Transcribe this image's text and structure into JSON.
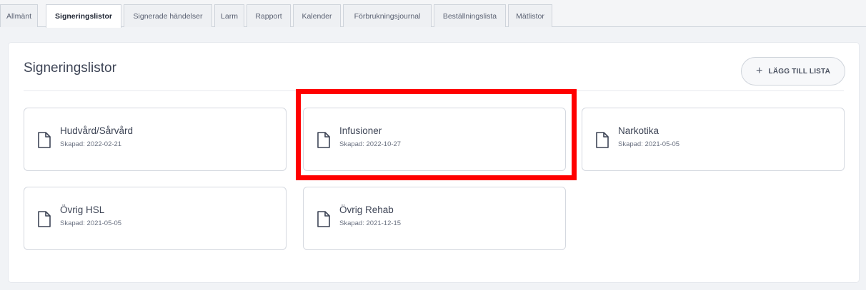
{
  "tabs": [
    {
      "label": "Allmänt",
      "active": false
    },
    {
      "label": "Signeringslistor",
      "active": true
    },
    {
      "label": "Signerade händelser",
      "active": false
    },
    {
      "label": "Larm",
      "active": false
    },
    {
      "label": "Rapport",
      "active": false
    },
    {
      "label": "Kalender",
      "active": false
    },
    {
      "label": "Förbrukningsjournal",
      "active": false
    },
    {
      "label": "Beställningslista",
      "active": false
    },
    {
      "label": "Mätlistor",
      "active": false
    }
  ],
  "main": {
    "title": "Signeringslistor",
    "add_button_label": "LÄGG TILL LISTA",
    "add_button_icon": "plus-icon"
  },
  "lists": [
    {
      "name": "Hudvård/Sårvård",
      "created": "Skapad: 2022-02-21",
      "icon": "document-icon"
    },
    {
      "name": "Infusioner",
      "created": "Skapad: 2022-10-27",
      "icon": "document-icon",
      "highlighted": true
    },
    {
      "name": "Narkotika",
      "created": "Skapad: 2021-05-05",
      "icon": "document-icon"
    },
    {
      "name": "Övrig HSL",
      "created": "Skapad: 2021-05-05",
      "icon": "document-icon"
    },
    {
      "name": "Övrig Rehab",
      "created": "Skapad: 2021-12-15",
      "icon": "document-icon"
    }
  ],
  "colors": {
    "highlight": "#ff0000",
    "card_border": "#d5d9e0",
    "page_bg": "#f1f3f6"
  }
}
